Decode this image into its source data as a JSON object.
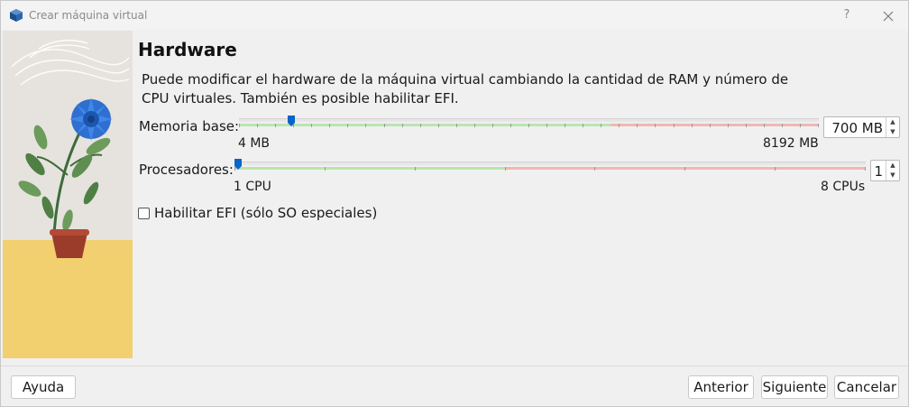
{
  "window": {
    "title": "Crear máquina virtual",
    "help_label": "?"
  },
  "page": {
    "heading": "Hardware",
    "description": "Puede modificar el hardware de la máquina virtual cambiando la cantidad de RAM y número de CPU virtuales. También es posible habilitar EFI."
  },
  "memory": {
    "label": "Memoria base:",
    "min_label": "4 MB",
    "max_label": "8192 MB",
    "value_text": "700 MB",
    "value": 700,
    "min": 4,
    "max": 8192
  },
  "processors": {
    "label": "Procesadores:",
    "min_label": "1 CPU",
    "max_label": "8 CPUs",
    "value_text": "1",
    "value": 1,
    "min": 1,
    "max": 8
  },
  "efi": {
    "label": "Habilitar EFI (sólo SO especiales)",
    "checked": false
  },
  "buttons": {
    "help": "Ayuda",
    "back": "Anterior",
    "next": "Siguiente",
    "cancel": "Cancelar"
  },
  "colors": {
    "handle": "#0a64c8",
    "green_band": "#b9e6b0",
    "red_band": "#f1b8b0"
  }
}
